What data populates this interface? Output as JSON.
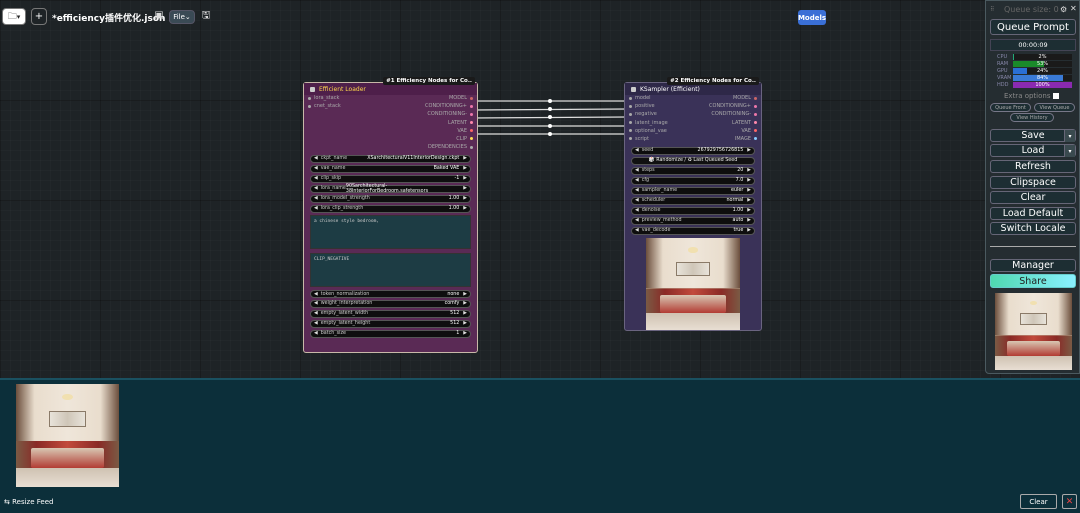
{
  "topbar": {
    "folder_label": "▾",
    "add_label": "+",
    "file_title": "*efficiency插件优化.json 3",
    "file_menu_label": "File",
    "models_label": "Models"
  },
  "node1": {
    "badge": "#1 Efficiency Nodes for Co..",
    "title": "Efficient Loader",
    "inputs": [
      "lora_stack",
      "cnet_stack"
    ],
    "outputs": [
      {
        "name": "MODEL",
        "color": "#c66"
      },
      {
        "name": "CONDITIONING+",
        "color": "#e7a"
      },
      {
        "name": "CONDITIONING-",
        "color": "#e7a"
      },
      {
        "name": "LATENT",
        "color": "#f8a"
      },
      {
        "name": "VAE",
        "color": "#f66"
      },
      {
        "name": "CLIP",
        "color": "#fd5"
      },
      {
        "name": "DEPENDENCIES",
        "color": "#aaa"
      }
    ],
    "widgets_top": [
      {
        "label": "ckpt_name",
        "value": "XSarchitecturalV11InteriorDesign.ckpt"
      },
      {
        "label": "vae_name",
        "value": "Baked VAE"
      },
      {
        "label": "clip_skip",
        "value": "-1"
      },
      {
        "label": "lora_name",
        "value": "90Sarchitectural-38InteriorForBedroom.safetensors"
      },
      {
        "label": "lora_model_strength",
        "value": "1.00"
      },
      {
        "label": "lora_clip_strength",
        "value": "1.00"
      }
    ],
    "positive_text": "a chinese style bedroom,",
    "negative_text": "CLIP_NEGATIVE",
    "widgets_bottom": [
      {
        "label": "token_normalization",
        "value": "none"
      },
      {
        "label": "weight_interpretation",
        "value": "comfy"
      },
      {
        "label": "empty_latent_width",
        "value": "512"
      },
      {
        "label": "empty_latent_height",
        "value": "512"
      },
      {
        "label": "batch_size",
        "value": "1"
      }
    ]
  },
  "node2": {
    "badge": "#2 Efficiency Nodes for Co..",
    "title": "KSampler (Efficient)",
    "inputs": [
      "model",
      "positive",
      "negative",
      "latent_image",
      "optional_vae",
      "script"
    ],
    "outputs": [
      {
        "name": "MODEL",
        "color": "#c66"
      },
      {
        "name": "CONDITIONING+",
        "color": "#e7a"
      },
      {
        "name": "CONDITIONING-",
        "color": "#e7a"
      },
      {
        "name": "LATENT",
        "color": "#f8a"
      },
      {
        "name": "VAE",
        "color": "#f66"
      },
      {
        "name": "IMAGE",
        "color": "#8cf"
      }
    ],
    "seed": {
      "label": "seed",
      "value": "267929756726815"
    },
    "randomize_label": "🎲 Randomize / ♻ Last Queued Seed",
    "widgets": [
      {
        "label": "steps",
        "value": "20"
      },
      {
        "label": "cfg",
        "value": "7.0"
      },
      {
        "label": "sampler_name",
        "value": "euler"
      },
      {
        "label": "scheduler",
        "value": "normal"
      },
      {
        "label": "denoise",
        "value": "1.00"
      },
      {
        "label": "preview_method",
        "value": "auto"
      },
      {
        "label": "vae_decode",
        "value": "true"
      }
    ]
  },
  "panel": {
    "queue_size": "Queue size: 0",
    "queue_prompt": "Queue Prompt",
    "timer": "00:00:09",
    "stats": [
      {
        "label": "CPU",
        "value": "2%",
        "pct": 2,
        "color": "#2a7"
      },
      {
        "label": "RAM",
        "value": "53%",
        "pct": 53,
        "color": "#1a8a2a"
      },
      {
        "label": "GPU",
        "value": "24%",
        "pct": 24,
        "color": "#2a6fd6"
      },
      {
        "label": "VRAM",
        "value": "84%",
        "pct": 84,
        "color": "#3a7ad6"
      },
      {
        "label": "HDD",
        "value": "100%",
        "pct": 100,
        "color": "#8a2ab0"
      }
    ],
    "extra_options": "Extra options",
    "queue_front": "Queue Front",
    "view_queue": "View Queue",
    "view_history": "View History",
    "buttons": [
      "Save",
      "Load",
      "Refresh",
      "Clipspace",
      "Clear",
      "Load Default",
      "Switch Locale"
    ],
    "manager": "Manager",
    "share": "Share"
  },
  "feed": {
    "resize_label": "⇆ Resize Feed",
    "clear_label": "Clear",
    "close_label": "✕"
  }
}
